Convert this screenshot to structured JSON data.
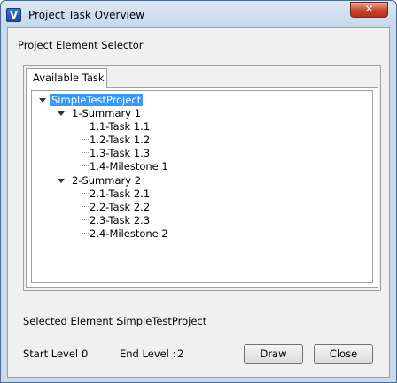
{
  "window": {
    "title": "Project Task Overview",
    "close_glyph": "✕",
    "icon_letter": "V"
  },
  "selector": {
    "label": "Project Element Selector"
  },
  "tab": {
    "label": "Available Task"
  },
  "tree": {
    "root": "SimpleTestProject",
    "summary1": {
      "label": "1-Summary 1",
      "children": [
        "1.1-Task 1.1",
        "1.2-Task 1.2",
        "1.3-Task 1.3",
        "1.4-Milestone 1"
      ]
    },
    "summary2": {
      "label": "2-Summary 2",
      "children": [
        "2.1-Task 2.1",
        "2.2-Task 2.2",
        "2.3-Task 2.3",
        "2.4-Milestone 2"
      ]
    }
  },
  "selected": {
    "label": "Selected Element :",
    "value": "SimpleTestProject"
  },
  "levels": {
    "start_label": "Start Level :",
    "start_value": "0",
    "end_label": "End Level :",
    "end_value": "2"
  },
  "buttons": {
    "draw": "Draw",
    "close": "Close"
  }
}
